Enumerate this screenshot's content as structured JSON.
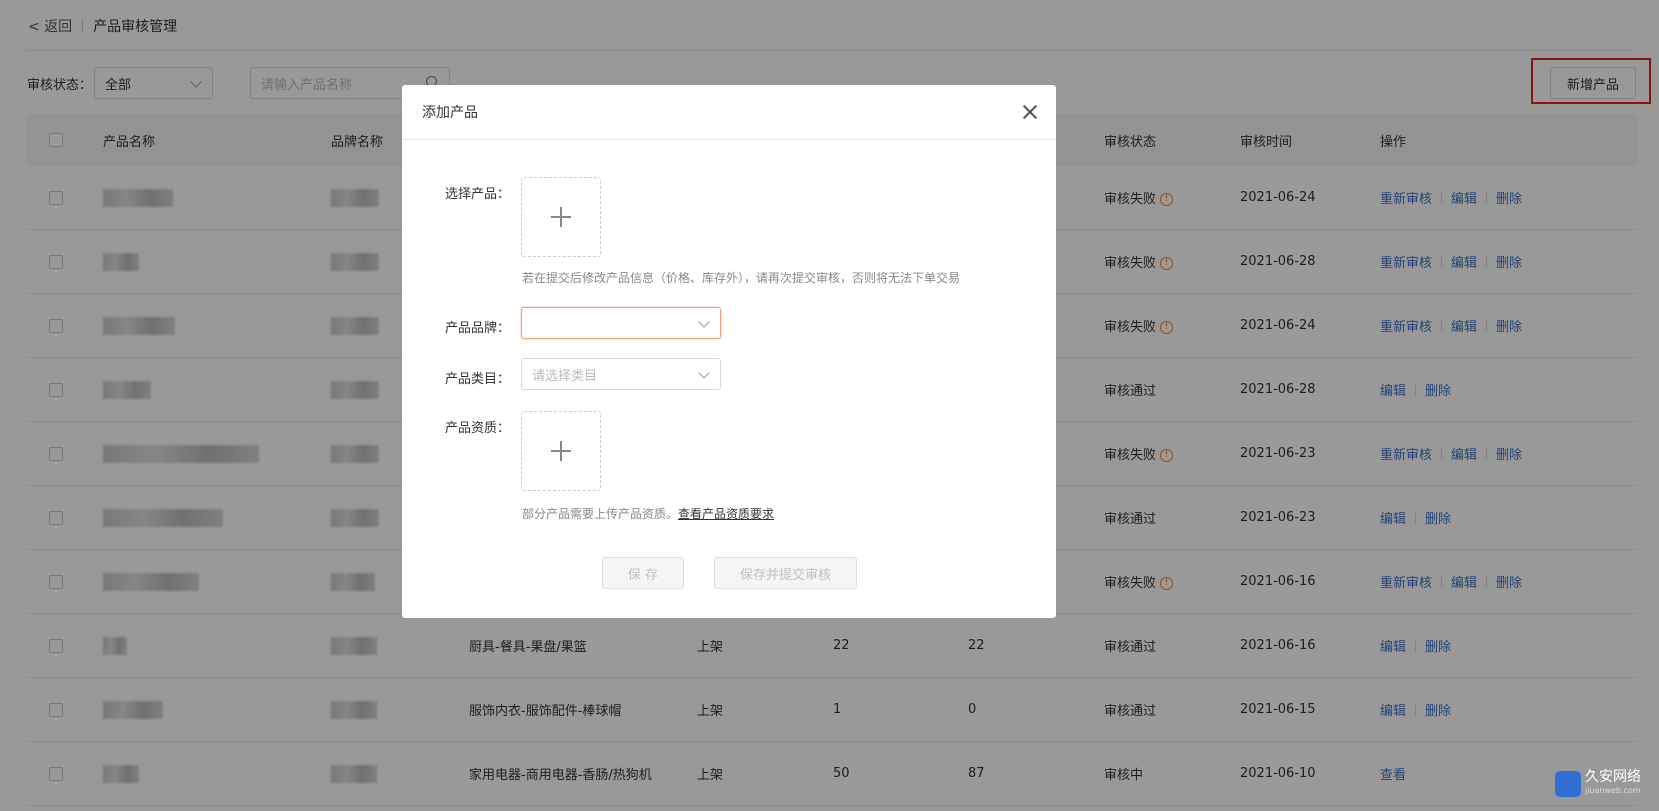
{
  "breadcrumb": {
    "back": "< 返回",
    "title": "产品审核管理"
  },
  "filter": {
    "label": "审核状态：",
    "status_value": "全部",
    "search_placeholder": "请输入产品名称"
  },
  "toolbar": {
    "add_label": "新增产品"
  },
  "table": {
    "headers": [
      "产品名称",
      "品牌名称",
      "审核状态",
      "审核时间",
      "操作"
    ],
    "rows": [
      {
        "category": "",
        "shelf": "",
        "n1": "",
        "n2": "",
        "status": "审核失败",
        "failed": true,
        "date": "2021-06-24",
        "ops": [
          "重新审核",
          "编辑",
          "删除"
        ]
      },
      {
        "category": "",
        "shelf": "",
        "n1": "",
        "n2": "",
        "status": "审核失败",
        "failed": true,
        "date": "2021-06-28",
        "ops": [
          "重新审核",
          "编辑",
          "删除"
        ]
      },
      {
        "category": "",
        "shelf": "",
        "n1": "",
        "n2": "",
        "status": "审核失败",
        "failed": true,
        "date": "2021-06-24",
        "ops": [
          "重新审核",
          "编辑",
          "删除"
        ]
      },
      {
        "category": "",
        "shelf": "",
        "n1": "",
        "n2": "",
        "status": "审核通过",
        "failed": false,
        "date": "2021-06-28",
        "ops": [
          "编辑",
          "删除"
        ]
      },
      {
        "category": "",
        "shelf": "",
        "n1": "",
        "n2": "",
        "status": "审核失败",
        "failed": true,
        "date": "2021-06-23",
        "ops": [
          "重新审核",
          "编辑",
          "删除"
        ]
      },
      {
        "category": "",
        "shelf": "",
        "n1": "",
        "n2": "",
        "status": "审核通过",
        "failed": false,
        "date": "2021-06-23",
        "ops": [
          "编辑",
          "删除"
        ]
      },
      {
        "category": "",
        "shelf": "",
        "n1": "",
        "n2": "",
        "status": "审核失败",
        "failed": true,
        "date": "2021-06-16",
        "ops": [
          "重新审核",
          "编辑",
          "删除"
        ]
      },
      {
        "category": "厨具-餐具-果盘/果篮",
        "shelf": "上架",
        "n1": "22",
        "n2": "22",
        "status": "审核通过",
        "failed": false,
        "date": "2021-06-16",
        "ops": [
          "编辑",
          "删除"
        ]
      },
      {
        "category": "服饰内衣-服饰配件-棒球帽",
        "shelf": "上架",
        "n1": "1",
        "n2": "0",
        "status": "审核通过",
        "failed": false,
        "date": "2021-06-15",
        "ops": [
          "编辑",
          "删除"
        ]
      },
      {
        "category": "家用电器-商用电器-香肠/热狗机",
        "shelf": "上架",
        "n1": "50",
        "n2": "87",
        "status": "审核中",
        "failed": false,
        "date": "2021-06-10",
        "ops": [
          "查看"
        ]
      }
    ]
  },
  "modal": {
    "title": "添加产品",
    "select_product_label": "选择产品：",
    "select_product_hint": "若在提交后修改产品信息（价格、库存外），请再次提交审核，否则将无法下单交易",
    "brand_label": "产品品牌：",
    "brand_value": "",
    "category_label": "产品类目：",
    "category_placeholder": "请选择类目",
    "qualification_label": "产品资质：",
    "qualification_hint": "部分产品需要上传产品资质。",
    "qualification_link": "查看产品资质要求",
    "save_label": "保 存",
    "save_submit_label": "保存并提交审核"
  },
  "watermark": {
    "name": "久安网络",
    "domain": "jiuanweb.com"
  }
}
